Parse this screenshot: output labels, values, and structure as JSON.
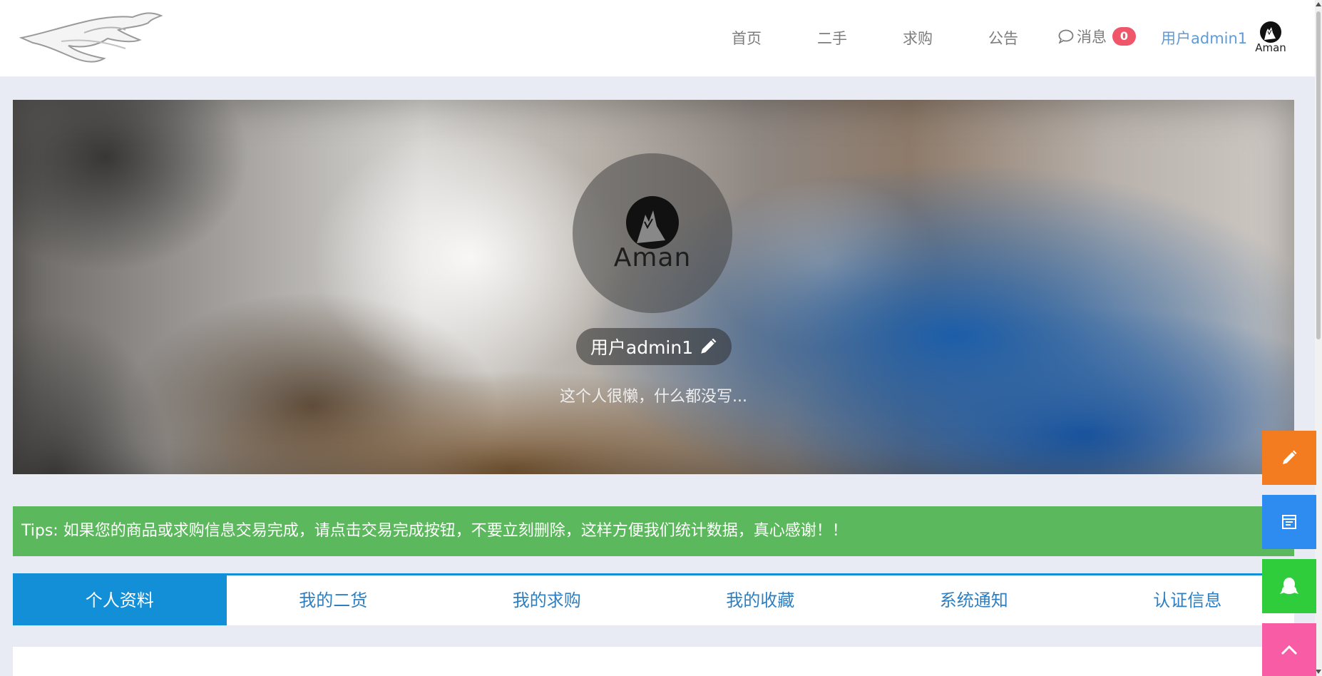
{
  "header": {
    "logo_icon": "greyhound-logo",
    "nav": [
      {
        "label": "首页"
      },
      {
        "label": "二手"
      },
      {
        "label": "求购"
      },
      {
        "label": "公告"
      }
    ],
    "messages": {
      "icon": "chat-bubble-icon",
      "label": "消息",
      "count": "0"
    },
    "user_link": "用户admin1",
    "avatar_caption": "Aman"
  },
  "profile": {
    "avatar_caption": "Aman",
    "username": "用户admin1",
    "edit_icon": "pencil-icon",
    "signature": "这个人很懒，什么都没写..."
  },
  "tips": "Tips: 如果您的商品或求购信息交易完成，请点击交易完成按钮，不要立刻删除，这样方便我们统计数据，真心感谢！！",
  "tabs": [
    {
      "label": "个人资料",
      "active": true
    },
    {
      "label": "我的二货"
    },
    {
      "label": "我的求购"
    },
    {
      "label": "我的收藏"
    },
    {
      "label": "系统通知"
    },
    {
      "label": "认证信息"
    }
  ],
  "side_buttons": [
    {
      "icon": "pencil-icon",
      "color": "#f47c20"
    },
    {
      "icon": "note-icon",
      "color": "#2e8bef"
    },
    {
      "icon": "qq-penguin-icon",
      "color": "#2fcc3b"
    },
    {
      "icon": "chevron-up-icon",
      "color": "#f85ca4"
    }
  ],
  "colors": {
    "tab_active": "#138fd8",
    "tips_bg": "#5cb85c",
    "badge": "#f0566a",
    "user_link": "#5f9bd6"
  }
}
